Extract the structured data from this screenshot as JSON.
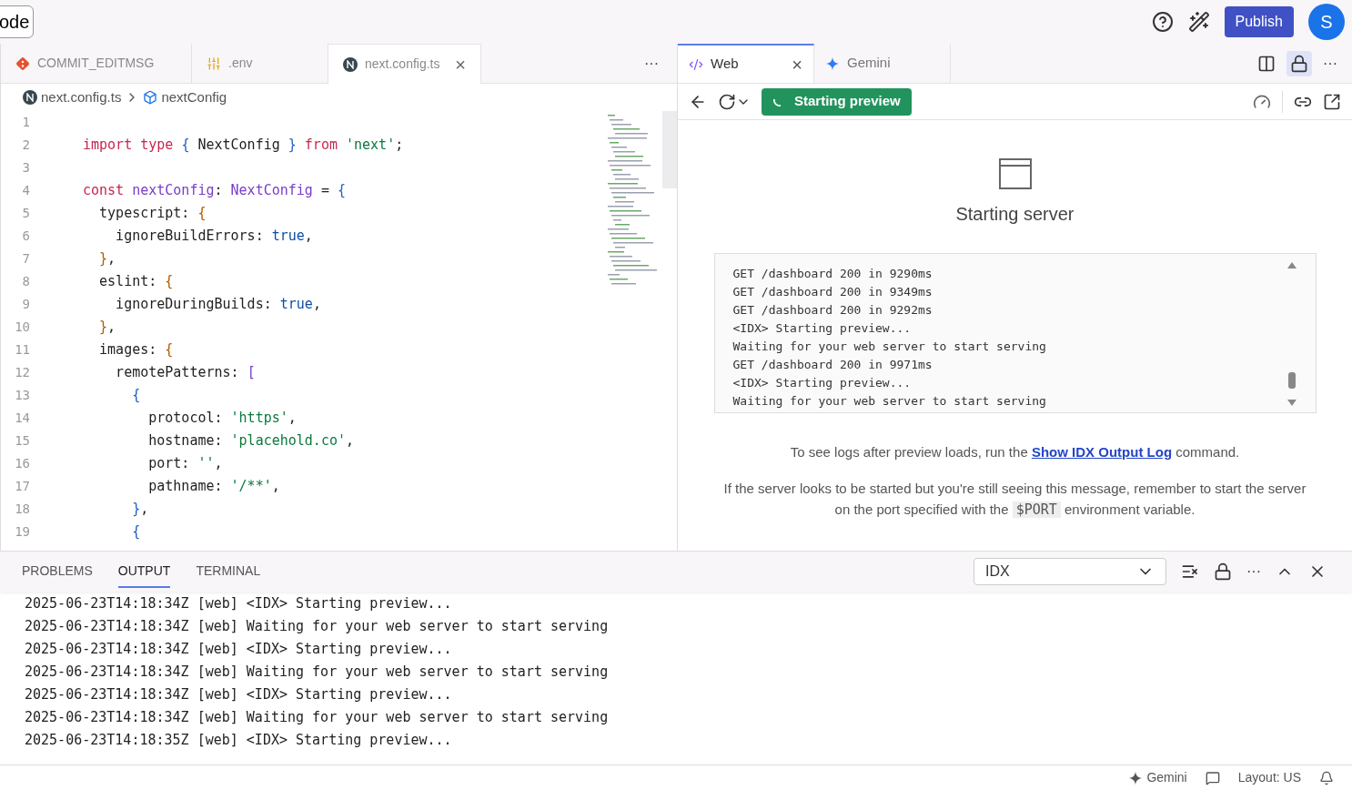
{
  "top_bar": {
    "title_fragment": "ode",
    "actions": [
      "Publish"
    ],
    "avatar": "S"
  },
  "editor_tabs": [
    {
      "label": "COMMIT_EDITMSG",
      "kind": "git",
      "selected": false
    },
    {
      "label": ".env",
      "kind": "env",
      "selected": false
    },
    {
      "label": "next.config.ts",
      "kind": "next",
      "selected": true,
      "close": "×"
    }
  ],
  "editor_more": "···",
  "breadcrumbs": [
    {
      "label": "next.config.ts",
      "kind": "file"
    },
    {
      "label": "nextConfig",
      "kind": "symbol"
    }
  ],
  "code_lines": [
    {
      "number": "1"
    },
    {
      "number": "2",
      "tokens": [
        {
          "t": "import type ",
          "kind": "kw"
        },
        {
          "t": "{ ",
          "kind": "br"
        },
        {
          "t": "NextConfig ",
          "kind": "pl"
        },
        {
          "t": "} ",
          "kind": "br"
        },
        {
          "t": "from ",
          "kind": "kw"
        },
        {
          "t": "'next'",
          "kind": "str"
        },
        {
          "t": ";",
          "kind": "pl"
        }
      ]
    },
    {
      "number": "3"
    },
    {
      "number": "4",
      "tokens": [
        {
          "t": "const ",
          "kind": "kw"
        },
        {
          "t": "nextConfig",
          "kind": "id"
        },
        {
          "t": ": ",
          "kind": "pl"
        },
        {
          "t": "NextConfig",
          "kind": "id"
        },
        {
          "t": " = ",
          "kind": "pl"
        },
        {
          "t": "{",
          "kind": "br"
        }
      ]
    },
    {
      "number": "5",
      "tokens": [
        {
          "t": "  typescript: ",
          "kind": "pl"
        },
        {
          "t": "{",
          "kind": "br2"
        }
      ]
    },
    {
      "number": "6",
      "tokens": [
        {
          "t": "    ignoreBuildErrors: ",
          "kind": "pl"
        },
        {
          "t": "true",
          "kind": "lit"
        },
        {
          "t": ",",
          "kind": "pl"
        }
      ]
    },
    {
      "number": "7",
      "tokens": [
        {
          "t": "  }",
          "kind": "br2"
        },
        {
          "t": ",",
          "kind": "pl"
        }
      ]
    },
    {
      "number": "8",
      "tokens": [
        {
          "t": "  eslint: ",
          "kind": "pl"
        },
        {
          "t": "{",
          "kind": "br2"
        }
      ]
    },
    {
      "number": "9",
      "tokens": [
        {
          "t": "    ignoreDuringBuilds: ",
          "kind": "pl"
        },
        {
          "t": "true",
          "kind": "lit"
        },
        {
          "t": ",",
          "kind": "pl"
        }
      ]
    },
    {
      "number": "10",
      "tokens": [
        {
          "t": "  }",
          "kind": "br2"
        },
        {
          "t": ",",
          "kind": "pl"
        }
      ]
    },
    {
      "number": "11",
      "tokens": [
        {
          "t": "  images: ",
          "kind": "pl"
        },
        {
          "t": "{",
          "kind": "br2"
        }
      ]
    },
    {
      "number": "12",
      "tokens": [
        {
          "t": "    remotePatterns: ",
          "kind": "pl"
        },
        {
          "t": "[",
          "kind": "br3"
        }
      ]
    },
    {
      "number": "13",
      "tokens": [
        {
          "t": "      {",
          "kind": "br"
        }
      ]
    },
    {
      "number": "14",
      "tokens": [
        {
          "t": "        protocol: ",
          "kind": "pl"
        },
        {
          "t": "'https'",
          "kind": "str"
        },
        {
          "t": ",",
          "kind": "pl"
        }
      ]
    },
    {
      "number": "15",
      "tokens": [
        {
          "t": "        hostname: ",
          "kind": "pl"
        },
        {
          "t": "'placehold.co'",
          "kind": "str"
        },
        {
          "t": ",",
          "kind": "pl"
        }
      ]
    },
    {
      "number": "16",
      "tokens": [
        {
          "t": "        port: ",
          "kind": "pl"
        },
        {
          "t": "''",
          "kind": "str"
        },
        {
          "t": ",",
          "kind": "pl"
        }
      ]
    },
    {
      "number": "17",
      "tokens": [
        {
          "t": "        pathname: ",
          "kind": "pl"
        },
        {
          "t": "'/**'",
          "kind": "str"
        },
        {
          "t": ",",
          "kind": "pl"
        }
      ]
    },
    {
      "number": "18",
      "tokens": [
        {
          "t": "      }",
          "kind": "br"
        },
        {
          "t": ",",
          "kind": "pl"
        }
      ]
    },
    {
      "number": "19",
      "tokens": [
        {
          "t": "      {",
          "kind": "br"
        }
      ]
    }
  ],
  "preview_tabs": [
    {
      "label": "Web",
      "kind": "web",
      "selected": true,
      "close": "×"
    },
    {
      "label": "Gemini",
      "kind": "gemini",
      "selected": false
    }
  ],
  "preview_more": "···",
  "preview_status": "Starting preview",
  "preview_heading": "Starting server",
  "preview_log": [
    "GET /dashboard 200 in 9290ms",
    "GET /dashboard 200 in 9349ms",
    "GET /dashboard 200 in 9292ms",
    "<IDX> Starting preview...",
    "Waiting for your web server to start serving",
    "GET /dashboard 200 in 9971ms",
    "<IDX> Starting preview...",
    "Waiting for your web server to start serving"
  ],
  "preview_hint": {
    "before": "To see logs after preview loads, run the ",
    "link": "Show IDX Output Log",
    "after": " command."
  },
  "preview_note": {
    "before": "If the server looks to be started but you're still seeing this message, remember to start the server on the port specified with the ",
    "code": "$PORT",
    "after": " environment variable."
  },
  "panel_tabs": [
    {
      "label": "PROBLEMS",
      "selected": false
    },
    {
      "label": "OUTPUT",
      "selected": true
    },
    {
      "label": "TERMINAL",
      "selected": false
    }
  ],
  "output_channel": "IDX",
  "panel_more": "···",
  "output_lines": [
    "2025-06-23T14:18:34Z [web] <IDX> Starting preview...",
    "2025-06-23T14:18:34Z [web] Waiting for your web server to start serving",
    "2025-06-23T14:18:34Z [web] <IDX> Starting preview...",
    "2025-06-23T14:18:34Z [web] Waiting for your web server to start serving",
    "2025-06-23T14:18:34Z [web] <IDX> Starting preview...",
    "2025-06-23T14:18:34Z [web] Waiting for your web server to start serving",
    "2025-06-23T14:18:35Z [web] <IDX> Starting preview..."
  ],
  "status_bar": {
    "gemini": "Gemini",
    "layout": "Layout: US"
  }
}
